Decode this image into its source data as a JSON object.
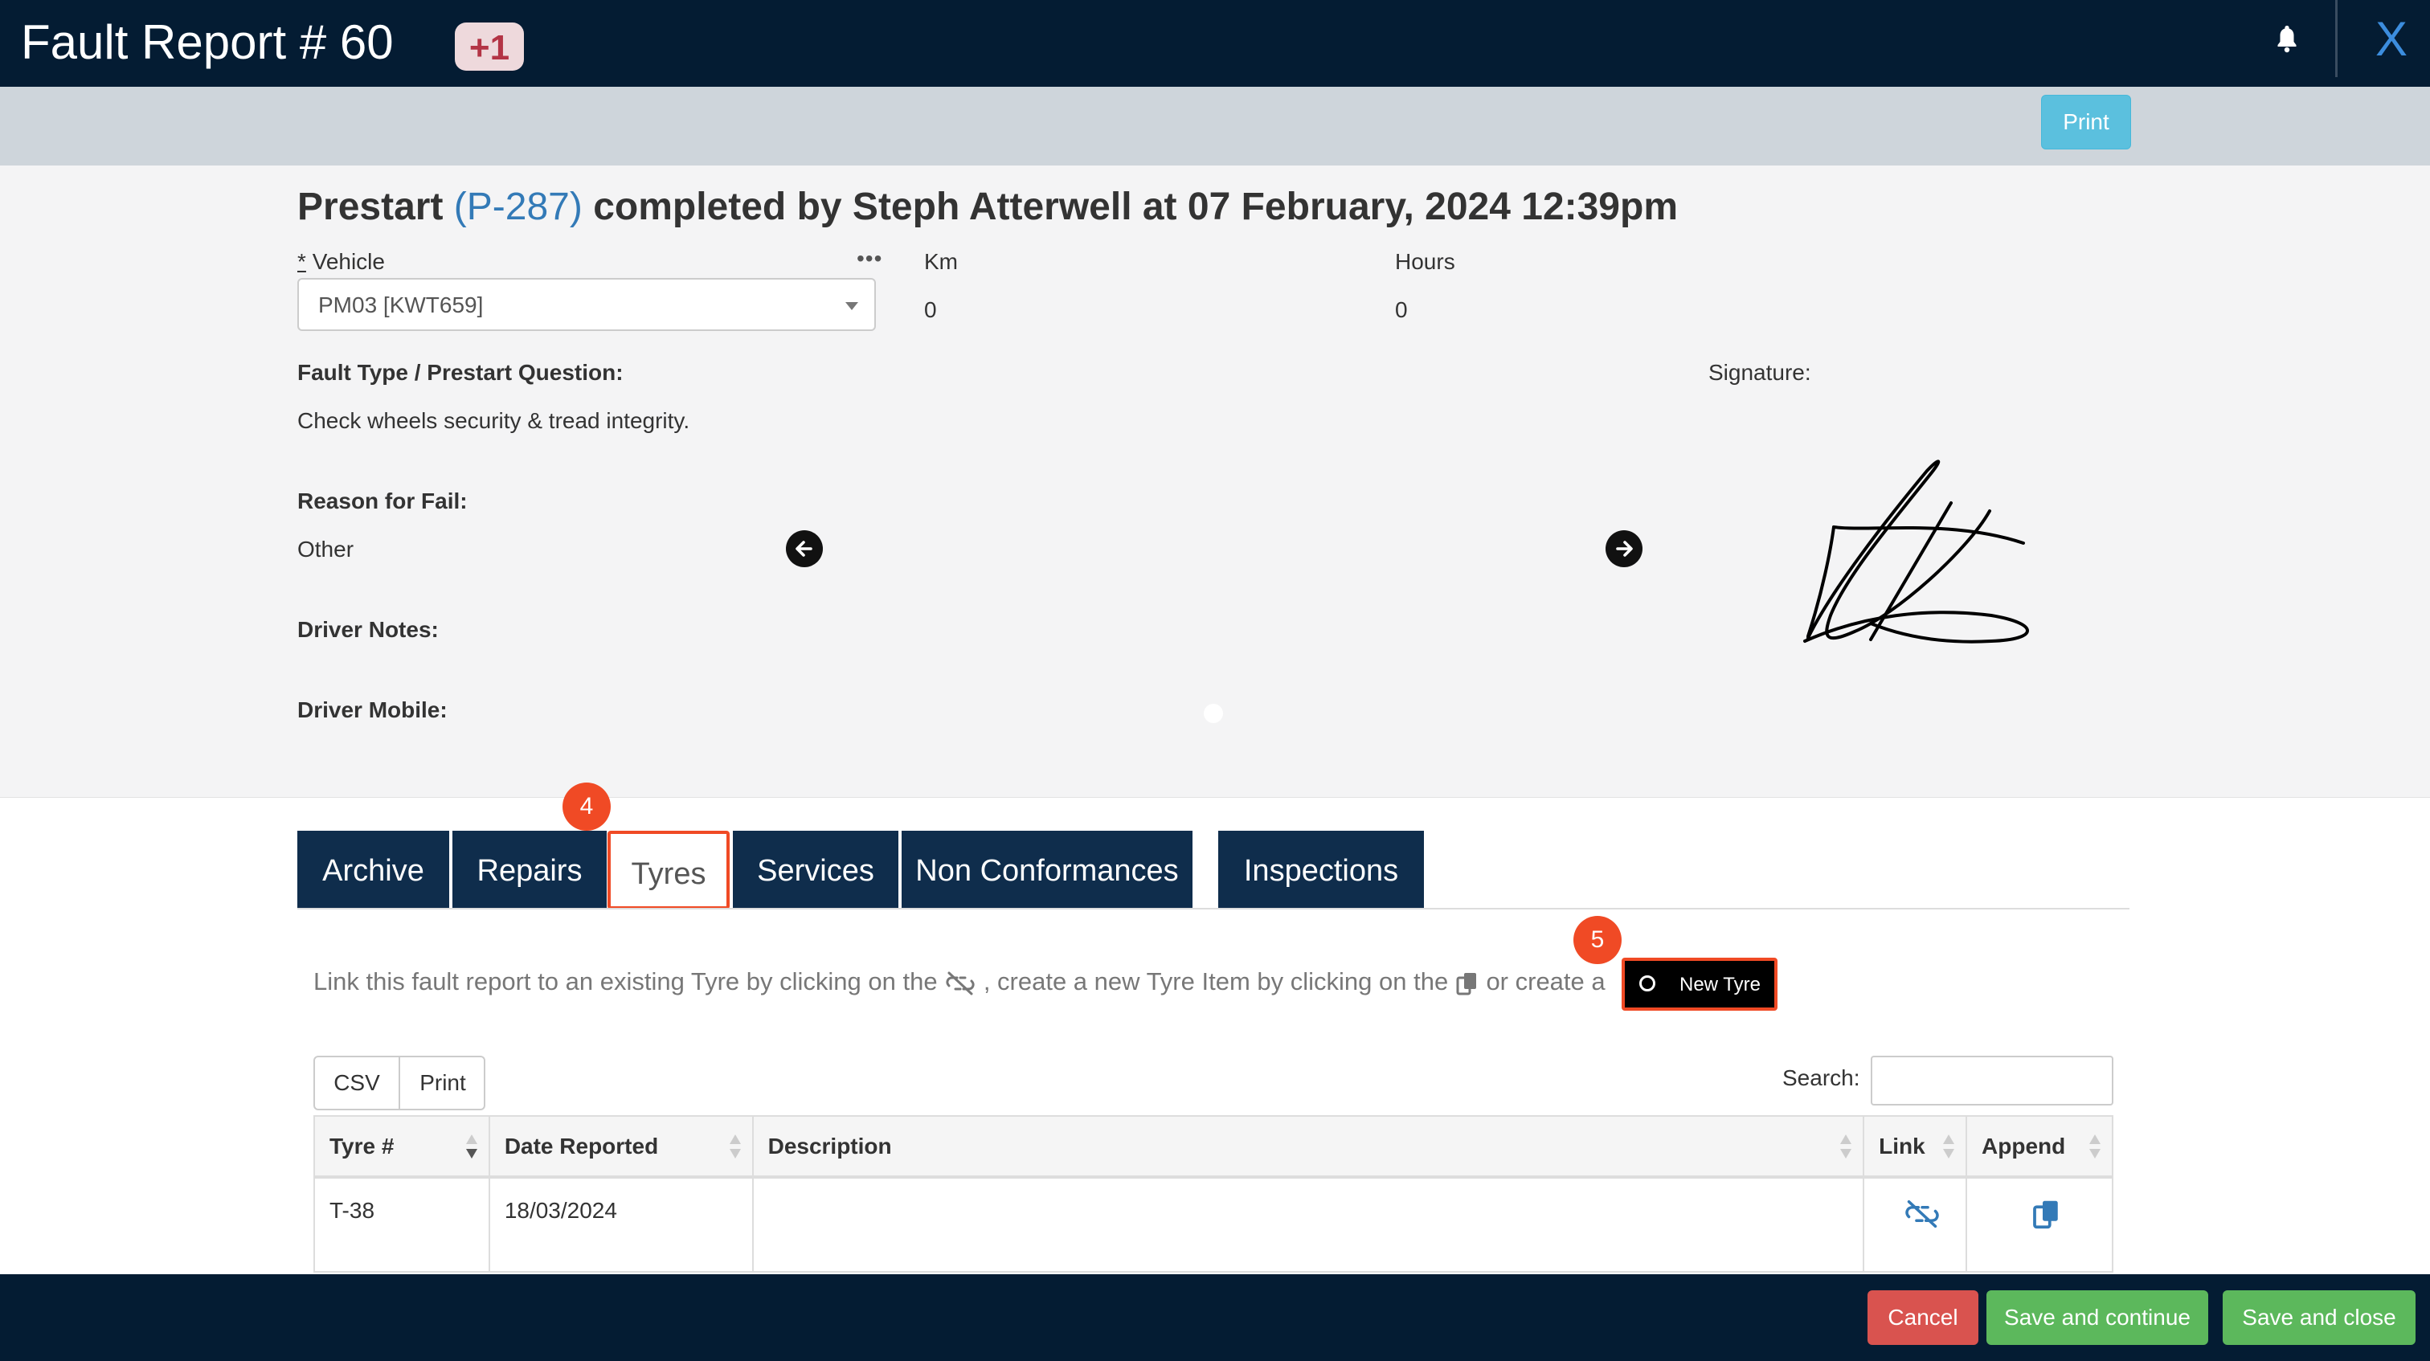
{
  "header": {
    "title": "Fault Report # 60",
    "badge": "+1",
    "close_label": "X",
    "print_label": "Print"
  },
  "prestart": {
    "prefix": "Prestart",
    "code": "(P-287)",
    "suffix": "completed by Steph Atterwell at 07 February, 2024 12:39pm"
  },
  "fields": {
    "vehicle_label": "Vehicle",
    "vehicle_required": "*",
    "vehicle_value": "PM03 [KWT659]",
    "more_label": "•••",
    "km_label": "Km",
    "km_value": "0",
    "hours_label": "Hours",
    "hours_value": "0",
    "fault_type_label": "Fault Type / Prestart Question:",
    "fault_type_value": "Check wheels security & tread integrity.",
    "reason_label": "Reason for Fail:",
    "reason_value": "Other",
    "driver_notes_label": "Driver Notes:",
    "driver_mobile_label": "Driver Mobile:",
    "signature_label": "Signature:"
  },
  "tabs": [
    "Archive",
    "Repairs",
    "Tyres",
    "Services",
    "Non Conformances",
    "Inspections"
  ],
  "active_tab": "Tyres",
  "markers": {
    "tab_marker": "4",
    "new_tyre_marker": "5"
  },
  "tyres": {
    "info_1": "Link this fault report to an existing Tyre by clicking on the",
    "info_2": ", create a new Tyre Item by clicking on the",
    "info_3": "or create a",
    "new_button": "New Tyre",
    "csv_label": "CSV",
    "print_label": "Print",
    "search_label": "Search:",
    "columns": [
      "Tyre #",
      "Date Reported",
      "Description",
      "Link",
      "Append"
    ],
    "rows": [
      {
        "tyre": "T-38",
        "date": "18/03/2024",
        "description": ""
      }
    ]
  },
  "footer": {
    "cancel": "Cancel",
    "save_continue": "Save and continue",
    "save_close": "Save and close"
  },
  "colors": {
    "navy": "#041c33",
    "tab_bg": "#0f2d4c",
    "link_blue": "#337ab7",
    "highlight": "#f04a25",
    "danger": "#d9534f",
    "success": "#5cb85c",
    "info": "#5bc0de"
  }
}
